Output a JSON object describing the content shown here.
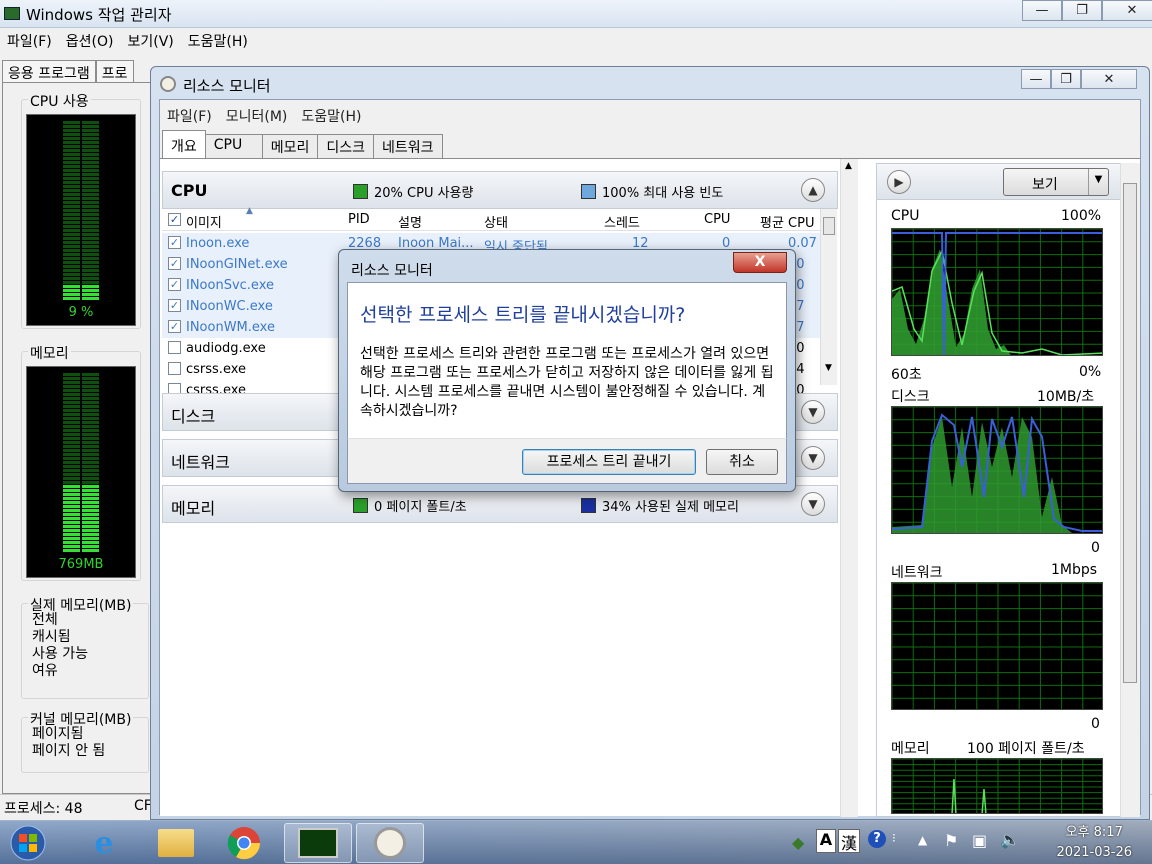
{
  "task_manager": {
    "title": "Windows 작업 관리자",
    "menu": [
      "파일(F)",
      "옵션(O)",
      "보기(V)",
      "도움말(H)"
    ],
    "tabs": [
      "응용 프로그램",
      "프로"
    ],
    "cpu_group_label": "CPU 사용",
    "cpu_value": "9 %",
    "cpu_fraction": 0.09,
    "mem_group_label": "메모리",
    "mem_value": "769MB",
    "mem_fraction": 0.38,
    "phys_mem_label": "실제 메모리(MB)",
    "phys_mem_items": [
      "전체",
      "캐시됨",
      "사용 가능",
      "여유"
    ],
    "kernel_mem_label": "커널 메모리(MB)",
    "kernel_mem_items": [
      "페이지됨",
      "페이지 안 됨"
    ],
    "status_processes": "프로세스: 48",
    "status_cpu": "CF"
  },
  "resource_monitor": {
    "title": "리소스 모니터",
    "menu": [
      "파일(F)",
      "모니터(M)",
      "도움말(H)"
    ],
    "tabs": [
      "개요",
      "CPU",
      "메모리",
      "디스크",
      "네트워크"
    ],
    "active_tab": "개요",
    "cpu_section": {
      "name": "CPU",
      "usage_label": "20% CPU 사용량",
      "freq_label": "100% 최대 사용 빈도",
      "usage_color": "#2aa02a",
      "freq_color": "#6fa8dc"
    },
    "columns": [
      "이미지",
      "PID",
      "설명",
      "상태",
      "스레드",
      "CPU",
      "평균 CPU"
    ],
    "processes": [
      {
        "name": "Inoon.exe",
        "pid": "2268",
        "desc": "Inoon Mai...",
        "status": "일시 중단됨",
        "threads": "12",
        "cpu": "0",
        "avg": "0.07",
        "checked": true
      },
      {
        "name": "INoonGINet.exe",
        "pid": "",
        "desc": "",
        "status": "",
        "threads": "",
        "cpu": "",
        "avg": "00",
        "checked": true
      },
      {
        "name": "INoonSvc.exe",
        "pid": "",
        "desc": "",
        "status": "",
        "threads": "",
        "cpu": "",
        "avg": "10",
        "checked": true
      },
      {
        "name": "INoonWC.exe",
        "pid": "",
        "desc": "",
        "status": "",
        "threads": "",
        "cpu": "",
        "avg": "07",
        "checked": true
      },
      {
        "name": "INoonWM.exe",
        "pid": "",
        "desc": "",
        "status": "",
        "threads": "",
        "cpu": "",
        "avg": "07",
        "checked": true
      },
      {
        "name": "audiodg.exe",
        "pid": "",
        "desc": "",
        "status": "",
        "threads": "",
        "cpu": "",
        "avg": "00",
        "checked": false
      },
      {
        "name": "csrss.exe",
        "pid": "",
        "desc": "",
        "status": "",
        "threads": "",
        "cpu": "",
        "avg": "14",
        "checked": false
      },
      {
        "name": "csrss.exe",
        "pid": "",
        "desc": "",
        "status": "",
        "threads": "",
        "cpu": "",
        "avg": "00",
        "checked": false
      }
    ],
    "disk_section": {
      "name": "디스크"
    },
    "network_section": {
      "name": "네트워크"
    },
    "memory_section": {
      "name": "메모리",
      "faults_label": "0 페이지 폴트/초",
      "used_label": "34% 사용된 실제 메모리",
      "faults_color": "#2aa02a",
      "used_color": "#1a2fa0"
    },
    "view_button": "보기",
    "graphs": [
      {
        "name": "CPU",
        "max": "100%",
        "time": "60초",
        "min": "0%"
      },
      {
        "name": "디스크",
        "max": "10MB/초",
        "min": "0"
      },
      {
        "name": "네트워크",
        "max": "1Mbps",
        "min": "0"
      },
      {
        "name": "메모리",
        "max": "100 페이지 폴트/초"
      }
    ]
  },
  "dialog": {
    "title": "리소스 모니터",
    "close_label": "X",
    "main_instruction": "선택한 프로세스 트리를 끝내시겠습니까?",
    "content": "선택한 프로세스 트리와 관련한 프로그램 또는 프로세스가 열려 있으면 해당 프로그램 또는 프로세스가 닫히고 저장하지 않은 데이터를 잃게 됩니다. 시스템 프로세스를 끝내면 시스템이 불안정해질 수 있습니다. 계속하시겠습니까?",
    "confirm_button": "프로세스 트리 끝내기",
    "cancel_button": "취소"
  },
  "taskbar": {
    "clock_time": "오후 8:17",
    "clock_date": "2021-03-26",
    "ime_label": "A",
    "hanja_label": "漢"
  }
}
